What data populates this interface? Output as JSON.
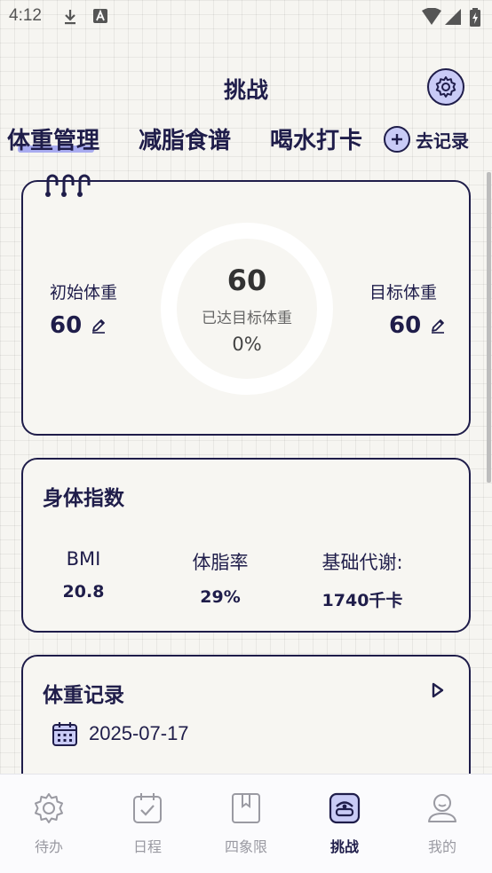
{
  "status_bar": {
    "time": "4:12"
  },
  "header": {
    "title": "挑战"
  },
  "tabs": [
    {
      "label": "体重管理",
      "active": true
    },
    {
      "label": "减脂食谱",
      "active": false
    },
    {
      "label": "喝水打卡",
      "active": false
    }
  ],
  "record_button": {
    "label": "去记录"
  },
  "weight_card": {
    "initial_label": "初始体重",
    "initial_value": "60",
    "target_label": "目标体重",
    "target_value": "60",
    "current_value": "60",
    "progress_label": "已达目标体重",
    "progress_percent": "0%",
    "progress_fraction": 0
  },
  "body_index": {
    "title": "身体指数",
    "metrics": [
      {
        "label": "BMI",
        "value": "20.8"
      },
      {
        "label": "体脂率",
        "value": "29%"
      },
      {
        "label": "基础代谢:",
        "value": "1740千卡"
      }
    ]
  },
  "weight_record": {
    "title": "体重记录",
    "date": "2025-07-17"
  },
  "bottom_nav": [
    {
      "label": "待办",
      "icon": "gear-icon",
      "active": false
    },
    {
      "label": "日程",
      "icon": "calendar-check-icon",
      "active": false
    },
    {
      "label": "四象限",
      "icon": "quadrant-icon",
      "active": false
    },
    {
      "label": "挑战",
      "icon": "challenge-icon",
      "active": true
    },
    {
      "label": "我的",
      "icon": "profile-icon",
      "active": false
    }
  ],
  "colors": {
    "accent": "#1f1d4a",
    "accent_light": "#c9cbf6",
    "ring_track": "#ffffff"
  }
}
